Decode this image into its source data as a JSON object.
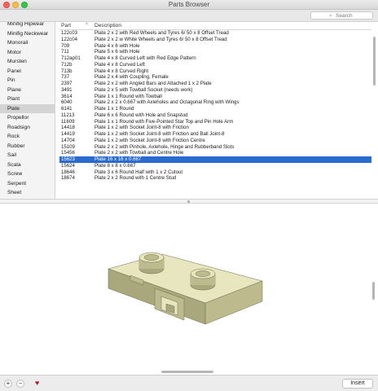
{
  "window": {
    "title": "Parts Browser"
  },
  "search": {
    "placeholder": "Search",
    "icon": "magnifier"
  },
  "sidebar": {
    "selected_index": 9,
    "items": [
      {
        "label": "Minifig Hipwear"
      },
      {
        "label": "Minifig Neckwear"
      },
      {
        "label": "Monorail"
      },
      {
        "label": "Motor"
      },
      {
        "label": "Mursten"
      },
      {
        "label": "Panel"
      },
      {
        "label": "Pin"
      },
      {
        "label": "Plane"
      },
      {
        "label": "Plant"
      },
      {
        "label": "Plate"
      },
      {
        "label": "Propellor"
      },
      {
        "label": "Roadsign"
      },
      {
        "label": "Rock"
      },
      {
        "label": "Rubber"
      },
      {
        "label": "Sail"
      },
      {
        "label": "Scala"
      },
      {
        "label": "Screw"
      },
      {
        "label": "Serpent"
      },
      {
        "label": "Sheet"
      }
    ]
  },
  "table": {
    "columns": {
      "part": "Part",
      "description": "Description",
      "sort_indicator": "^"
    },
    "selected_index": 20,
    "rows": [
      {
        "part": "122c03",
        "description": "Plate  2 x  2 with Red Wheels and Tyres 6/ 50 x 8 Offset Tread"
      },
      {
        "part": "122c04",
        "description": "Plate  2 x  2 w White Wheels and Tyres 6/ 50 x 8 Offset Tread"
      },
      {
        "part": "709",
        "description": "Plate  4 x  6 with Hole"
      },
      {
        "part": "711",
        "description": "Plate  5 x  6 with Hole"
      },
      {
        "part": "712ap01",
        "description": "Plate  4 x  8 Curved Left with Red Edge Pattern"
      },
      {
        "part": "712b",
        "description": "Plate  4 x  8 Curved Left"
      },
      {
        "part": "713b",
        "description": "Plate  4 x  8 Curved Right"
      },
      {
        "part": "737",
        "description": "Plate  2 x  4 with Coupling, Female"
      },
      {
        "part": "2397",
        "description": "Plate  2 x  2 with Angled Bars and Attached  1 x  2 Plate"
      },
      {
        "part": "3491",
        "description": "Plate  2 x  5 with Towball Socket (needs work)"
      },
      {
        "part": "3614",
        "description": "Plate  1 x  1 Round with Towball"
      },
      {
        "part": "6040",
        "description": "Plate  2 x  2 x  0.667 with Axleholes and Octagonal Ring with Wings"
      },
      {
        "part": "6141",
        "description": "Plate  1 x  1 Round"
      },
      {
        "part": "11213",
        "description": "Plate  6 x  6 Round with Hole and Snapstud"
      },
      {
        "part": "11609",
        "description": "Plate  1 x  1 Round with Five-Pointed Star Top and Pin Hole Arm"
      },
      {
        "part": "14418",
        "description": "Plate  1 x  2 with Socket Joint-8 with Friction"
      },
      {
        "part": "14419",
        "description": "Plate  1 x  2 with Socket Joint-8 with Friction and Ball Joint-8"
      },
      {
        "part": "14704",
        "description": "Plate  1 x  2 with Socket Joint-8 with Friction Centre"
      },
      {
        "part": "15109",
        "description": "Plate  2 x  2 with Pinhole, Axlehole, Hinge and Rubberband Slots"
      },
      {
        "part": "15456",
        "description": "Plate  2 x  2 with Towball and Centre Hole"
      },
      {
        "part": "15623",
        "description": "Plate 16 x 16 x  0.667"
      },
      {
        "part": "15624",
        "description": "Plate  8 x  8 x  0.667"
      },
      {
        "part": "18646",
        "description": "Plate  3 x  6 Round Half with  1 x  2 Cutout"
      },
      {
        "part": "18674",
        "description": "Plate  2 x  2 Round with  1 Centre Stud"
      }
    ]
  },
  "preview": {
    "model_color": "#e8e6bf",
    "shade_color": "#bdbb8e",
    "dark_color": "#a9a77c"
  },
  "bottom": {
    "add_label": "+",
    "remove_label": "−",
    "favorite_icon": "heart",
    "insert_label": "Insert"
  }
}
